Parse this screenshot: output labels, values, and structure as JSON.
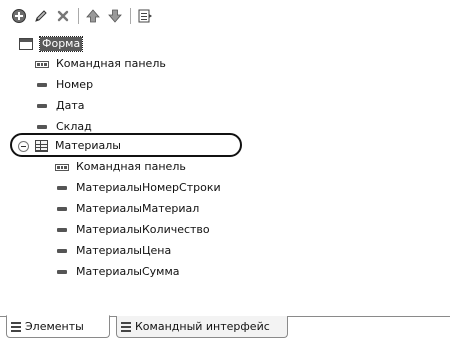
{
  "toolbar": {
    "buttons": [
      "add-icon",
      "edit-icon",
      "delete-icon",
      "move-up-icon",
      "move-down-icon",
      "form-properties-icon"
    ]
  },
  "tree": {
    "root_label": "Форма",
    "items": [
      {
        "label": "Командная панель",
        "icon": "command-bar-icon"
      },
      {
        "label": "Номер",
        "icon": "field-icon"
      },
      {
        "label": "Дата",
        "icon": "field-icon"
      },
      {
        "label": "Склад",
        "icon": "field-icon"
      }
    ],
    "table": {
      "label": "Материалы",
      "icon": "table-icon",
      "children": [
        {
          "label": "Командная панель",
          "icon": "command-bar-icon"
        },
        {
          "label": "МатериалыНомерСтроки",
          "icon": "field-icon"
        },
        {
          "label": "МатериалыМатериал",
          "icon": "field-icon"
        },
        {
          "label": "МатериалыКоличество",
          "icon": "field-icon"
        },
        {
          "label": "МатериалыЦена",
          "icon": "field-icon"
        },
        {
          "label": "МатериалыСумма",
          "icon": "field-icon"
        }
      ]
    }
  },
  "tabs": [
    {
      "label": "Элементы",
      "active": true
    },
    {
      "label": "Командный интерфейс",
      "active": false
    }
  ]
}
